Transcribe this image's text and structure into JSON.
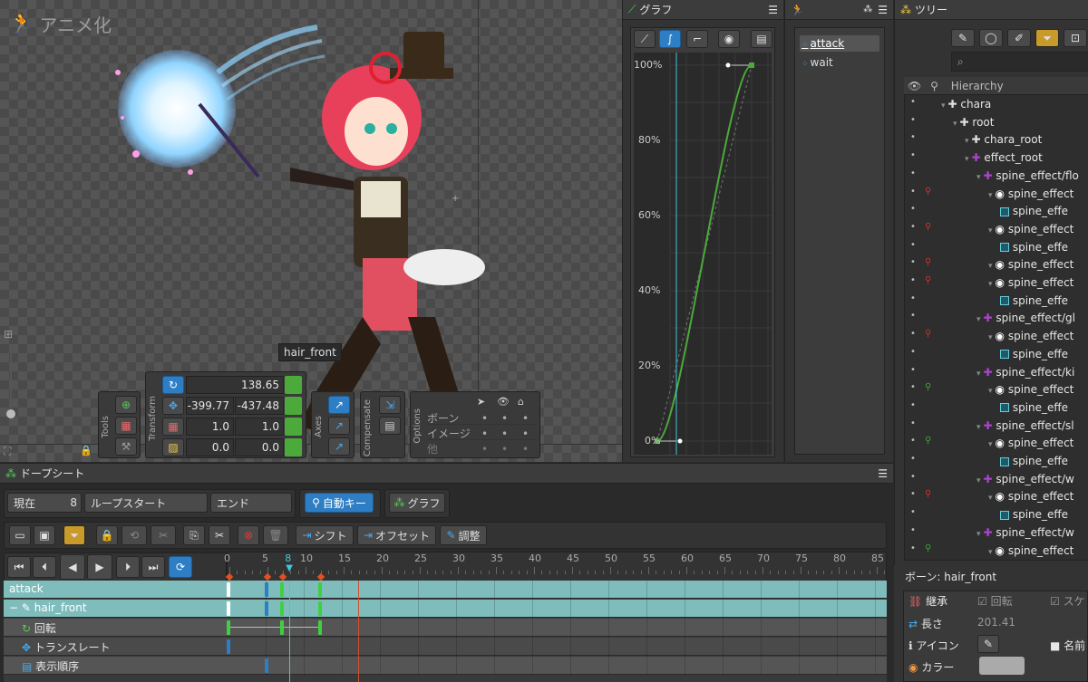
{
  "viewport": {
    "title": "アニメ化",
    "tooltip": "hair_front"
  },
  "tools": {
    "label": "Tools"
  },
  "transform": {
    "label": "Transform",
    "rotate": "138.65",
    "tx": "-399.77",
    "ty": "-437.48",
    "sx": "1.0",
    "sy": "1.0",
    "shx": "0.0",
    "shy": "0.0"
  },
  "axes": {
    "label": "Axes"
  },
  "compensate": {
    "label": "Compensate"
  },
  "options": {
    "label": "Options",
    "rows": [
      "ボーン",
      "イメージ",
      "他"
    ]
  },
  "graph": {
    "title": "グラフ",
    "ylabels": [
      "100%",
      "80%",
      "60%",
      "40%",
      "20%",
      "0%"
    ]
  },
  "anims": {
    "items": [
      "attack",
      "wait"
    ]
  },
  "tree": {
    "title": "ツリー",
    "hierarchy": "Hierarchy",
    "items": [
      "chara",
      "root",
      "chara_root",
      "effect_root",
      "spine_effect/flo",
      "spine_effect",
      "spine_effe",
      "spine_effect",
      "spine_effe",
      "spine_effect",
      "spine_effect",
      "spine_effe",
      "spine_effect/gl",
      "spine_effect",
      "spine_effe",
      "spine_effect/ki",
      "spine_effect",
      "spine_effe",
      "spine_effect/sl",
      "spine_effect",
      "spine_effe",
      "spine_effect/w",
      "spine_effect",
      "spine_effe",
      "spine_effect/w",
      "spine_effect"
    ]
  },
  "props": {
    "bone": "ボーン: hair_front",
    "inherit": "継承",
    "rotate": "回転",
    "scale": "スケ",
    "length": "長さ",
    "length_val": "201.41",
    "icon": "アイコン",
    "name": "名前",
    "color": "カラー"
  },
  "dope": {
    "title": "ドープシート",
    "current": "現在",
    "frame": "8",
    "loopstart": "ループスタート",
    "end": "エンド",
    "autokey": "自動キー",
    "graph": "グラフ",
    "shift": "シフト",
    "offset": "オフセット",
    "adjust": "調整",
    "ticks": [
      "0",
      "5",
      "8",
      "10",
      "15",
      "20",
      "25",
      "30",
      "35",
      "40",
      "45",
      "50",
      "55",
      "60",
      "65",
      "70",
      "75",
      "80",
      "85"
    ],
    "rows": [
      "attack",
      "hair_front",
      "回転",
      "トランスレート",
      "表示順序"
    ]
  }
}
